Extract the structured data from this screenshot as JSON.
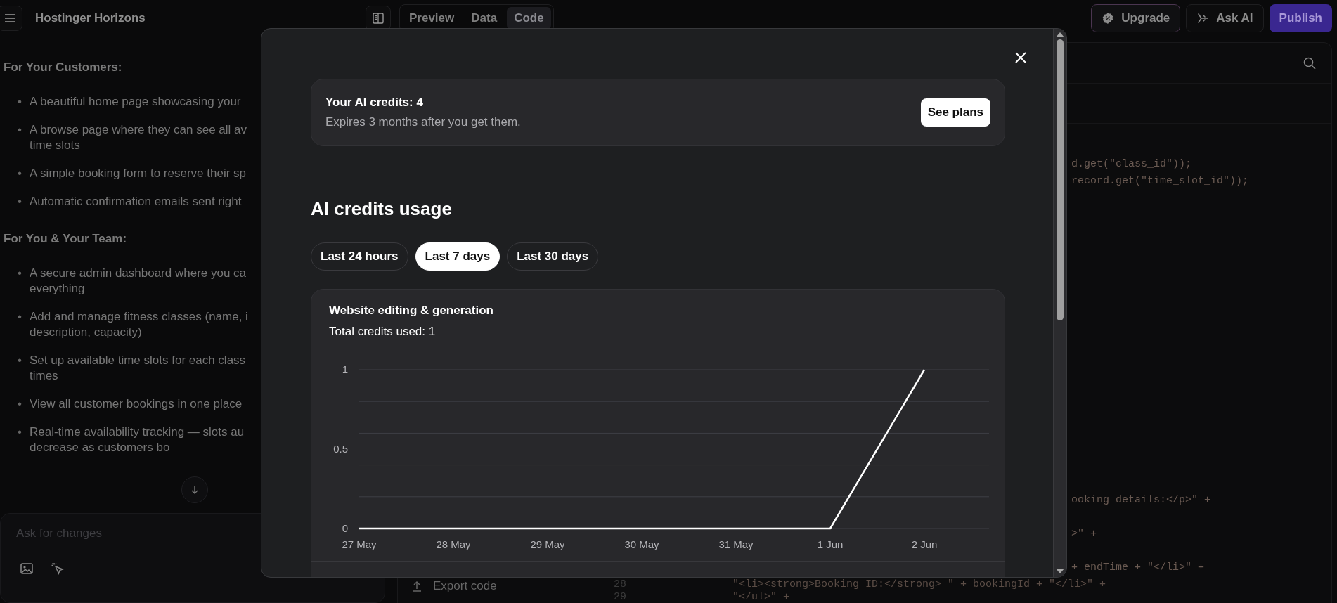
{
  "top_bar": {
    "app_name": "Hostinger Horizons",
    "view_tabs": [
      {
        "label": "Preview",
        "selected": false
      },
      {
        "label": "Data",
        "selected": false
      },
      {
        "label": "Code",
        "selected": true
      }
    ],
    "buttons": [
      {
        "label": "Upgrade",
        "kind": "upgrade"
      },
      {
        "label": "Ask AI",
        "kind": "ask"
      },
      {
        "label": "Publish",
        "kind": "publish"
      }
    ]
  },
  "chat": {
    "sections": [
      {
        "heading": "For Your Customers:",
        "bullet": "•",
        "items": [
          "A beautiful home page showcasing your",
          "A browse page where they can see all av time slots",
          "A simple booking form to reserve their sp",
          "Automatic confirmation emails sent right"
        ]
      },
      {
        "heading": "For You & Your Team:",
        "bullet": "•",
        "items": [
          "A secure admin dashboard where you ca everything",
          "Add and manage fitness classes (name, i description, capacity)",
          "Set up available time slots for each class times",
          "View all customer bookings in one place",
          "Real-time availability tracking — slots au decrease as customers bo"
        ]
      }
    ],
    "input": {
      "placeholder": "Ask for changes"
    }
  },
  "code_panel": {
    "export_button": "Export code",
    "fragments": [
      "d.get(\"class_id\"));",
      "record.get(\"time_slot_id\"));",
      "ooking details:</p>\" +",
      ">\" +",
      "+ endTime + \"</li>\" +"
    ],
    "lines": [
      {
        "number": "28",
        "text": "\"<li><strong>Booking ID:</strong> \" + bookingId + \"</li>\" +"
      },
      {
        "number": "29",
        "text": "\"</ul>\" +"
      }
    ]
  },
  "modal": {
    "credits": {
      "title": "Your AI credits: 4",
      "subtitle": "Expires 3 months after you get them.",
      "button": "See plans"
    },
    "usage_title": "AI credits usage",
    "ranges": [
      {
        "label": "Last 24 hours",
        "selected": false
      },
      {
        "label": "Last 7 days",
        "selected": true
      },
      {
        "label": "Last 30 days",
        "selected": false
      }
    ],
    "chart_card": {
      "title": "Website editing & generation",
      "total": "Total credits used: 1",
      "chart_data": {
        "type": "line",
        "categories": [
          "27 May",
          "28 May",
          "29 May",
          "30 May",
          "31 May",
          "1 Jun",
          "2 Jun"
        ],
        "series": [
          {
            "color": "#ffffff",
            "values": [
              0,
              0,
              0,
              0,
              0,
              0,
              1
            ]
          }
        ],
        "ylim": [
          0,
          1
        ],
        "yticks": [
          0,
          0.5,
          1
        ]
      }
    }
  }
}
